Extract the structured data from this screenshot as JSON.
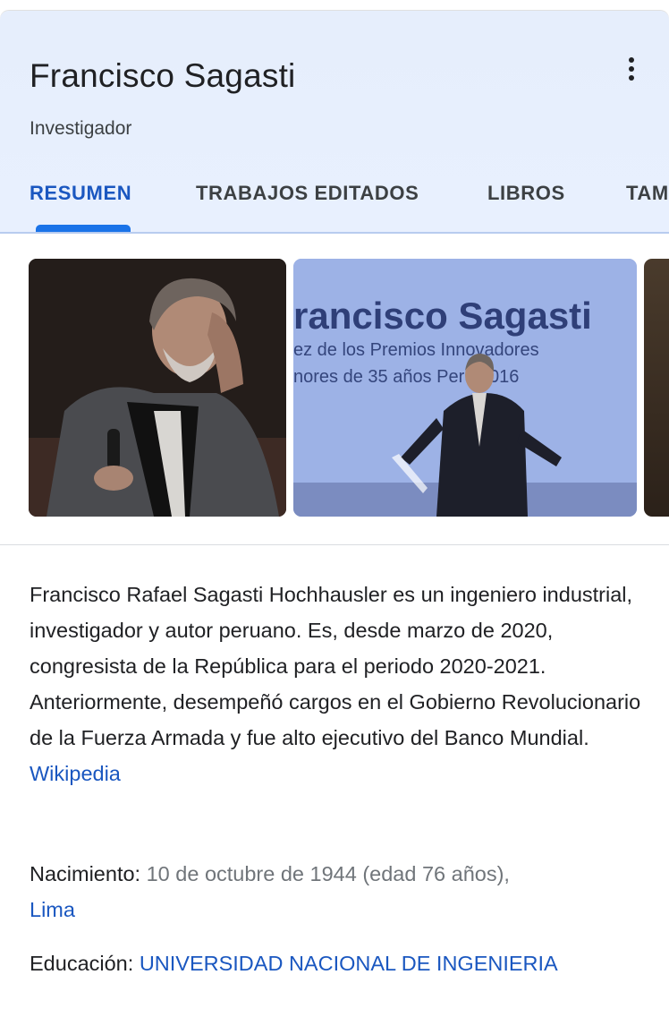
{
  "header": {
    "title": "Francisco Sagasti",
    "subtitle": "Investigador"
  },
  "tabs": [
    {
      "label": "RESUMEN",
      "active": true
    },
    {
      "label": "TRABAJOS EDITADOS",
      "active": false
    },
    {
      "label": "LIBROS",
      "active": false
    },
    {
      "label": "TAM",
      "active": false
    }
  ],
  "photos": {
    "photo2_banner_line1": "rancisco Sagasti",
    "photo2_banner_line2": "ez de los Premios Innovadores",
    "photo2_banner_line3": "nores de 35 años Perú 2016"
  },
  "description": {
    "text": "Francisco Rafael Sagasti Hochhausler es un ingeniero industrial, investigador y autor peruano. Es, desde marzo de 2020, congresista de la República para el periodo 2020-2021. Anteriormente, desempeñó cargos en el Gobierno Revolucionario de la Fuerza Armada y fue alto ejecutivo del Banco Mundial.",
    "source_link": "Wikipedia"
  },
  "facts": {
    "birth_label": "Nacimiento:",
    "birth_value": "10 de octubre de 1944 (edad 76 años),",
    "birth_place": "Lima",
    "education_label": "Educación:",
    "education_value": "UNIVERSIDAD NACIONAL DE INGENIERIA"
  },
  "colors": {
    "accent": "#1a73e8",
    "link": "#1a57c0",
    "header_bg": "#e8f0fe"
  },
  "icons": {
    "menu": "more-vert-icon"
  }
}
